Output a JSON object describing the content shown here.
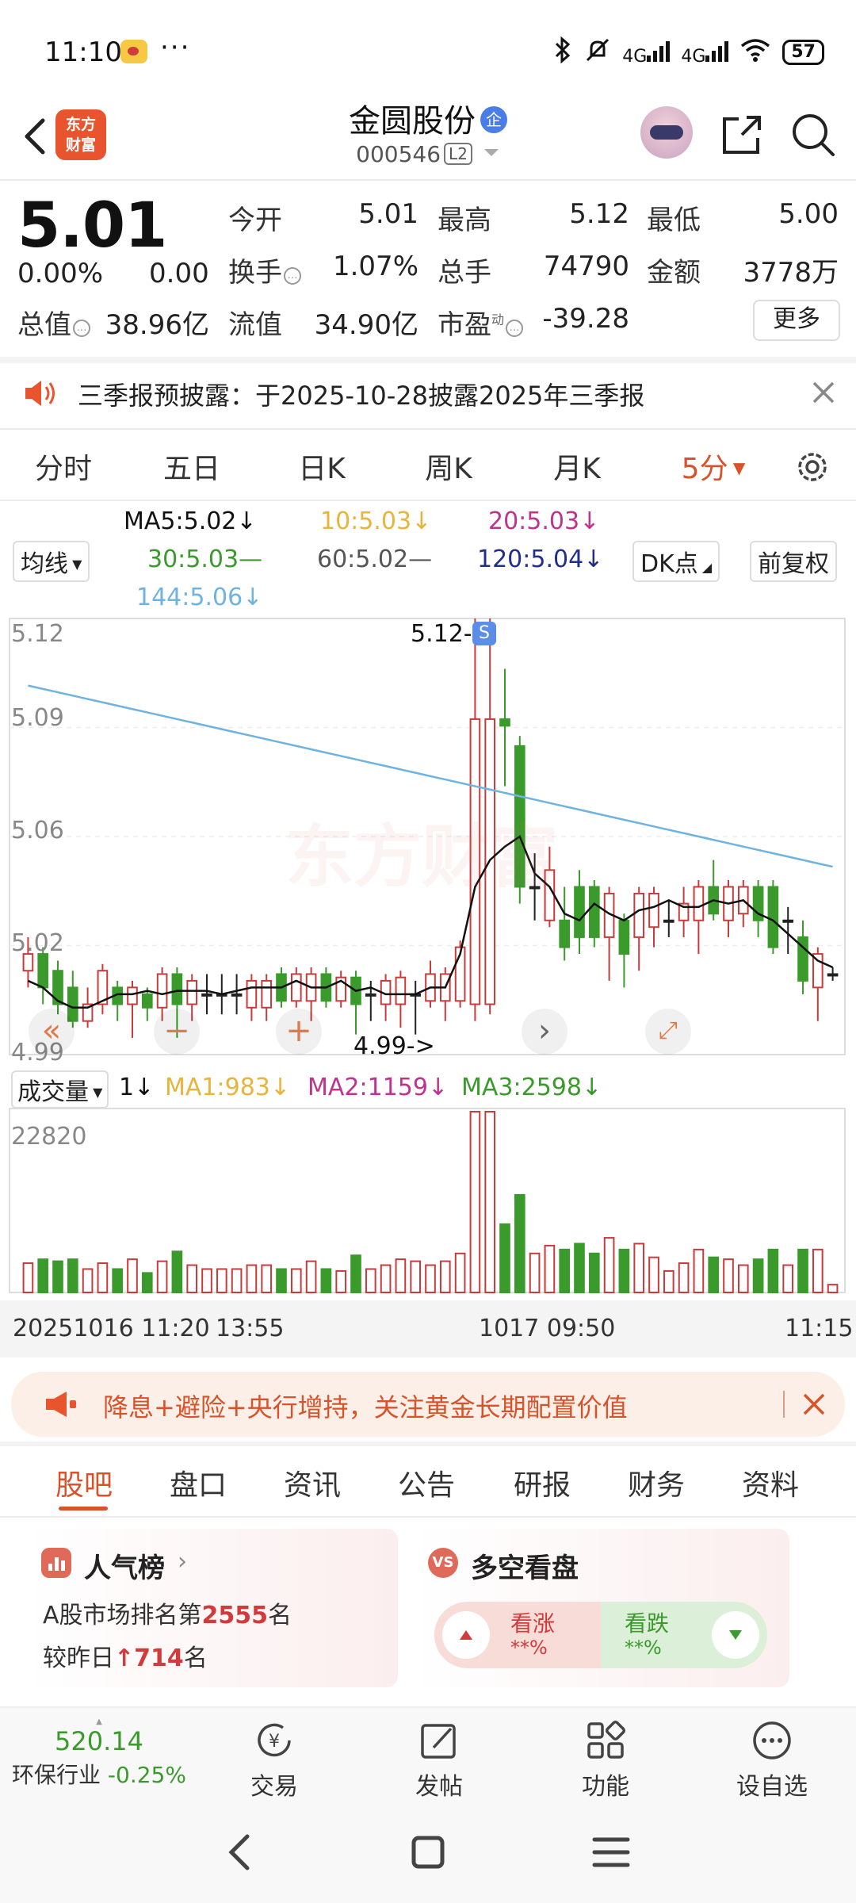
{
  "status_bar": {
    "time": "11:10",
    "dots": "···",
    "net1": "4G",
    "net2": "4G",
    "battery": "57"
  },
  "header": {
    "logo_line1": "东方",
    "logo_line2": "财富",
    "stock_name": "金圆股份",
    "badge": "企",
    "stock_code": "000546",
    "level_badge": "L2"
  },
  "quote": {
    "price": "5.01",
    "change_pct": "0.00%",
    "change_abs": "0.00",
    "open_label": "今开",
    "open": "5.01",
    "high_label": "最高",
    "high": "5.12",
    "low_label": "最低",
    "low": "5.00",
    "turnover_label": "换手",
    "turnover": "1.07%",
    "volume_label": "总手",
    "volume": "74790",
    "amount_label": "金额",
    "amount": "3778万",
    "mktcap_label": "总值",
    "mktcap": "38.96亿",
    "float_label": "流值",
    "float": "34.90亿",
    "pe_label": "市盈",
    "pe_sup": "动",
    "pe": "-39.28",
    "more_label": "更多"
  },
  "notice": {
    "text": "三季报预披露：于2025-10-28披露2025年三季报"
  },
  "period_tabs": [
    "分时",
    "五日",
    "日K",
    "周K",
    "月K",
    "5分"
  ],
  "ma_legend": {
    "selector": "均线",
    "ma5": "MA5:5.02↓",
    "ma10": "10:5.03↓",
    "ma20": "20:5.03↓",
    "ma30": "30:5.03—",
    "ma60": "60:5.02—",
    "ma120": "120:5.04↓",
    "ma144": "144:5.06↓",
    "dk_label": "DK点",
    "adjust_label": "前复权",
    "colors": {
      "ma5": "#111111",
      "ma10": "#e8b43a",
      "ma20": "#c0338c",
      "ma30": "#3a9a2c",
      "ma60": "#555555",
      "ma120": "#1f2f8a",
      "ma144": "#6fb3e0"
    }
  },
  "kline": {
    "y_labels": [
      "5.12",
      "5.09",
      "5.06",
      "5.02",
      "4.99"
    ],
    "high_marker": "5.12->",
    "low_marker": "4.99->",
    "watermark": "东方财富"
  },
  "volume": {
    "selector": "成交量",
    "num": "1↓",
    "ma1": "MA1:983↓",
    "ma2": "MA2:1159↓",
    "ma3": "MA3:2598↓",
    "y_top": "22820",
    "x_labels": [
      "20251016 11:20",
      "13:55",
      "1017 09:50",
      "11:15"
    ]
  },
  "chart_data": {
    "type": "candlestick",
    "ylim": [
      4.99,
      5.12
    ],
    "candles": [
      {
        "o": 5.015,
        "c": 5.02,
        "h": 5.025,
        "l": 5.01
      },
      {
        "o": 5.02,
        "c": 5.01,
        "h": 5.022,
        "l": 5.005
      },
      {
        "o": 5.015,
        "c": 5.005,
        "h": 5.018,
        "l": 5.002
      },
      {
        "o": 5.01,
        "c": 5.0,
        "h": 5.015,
        "l": 4.998
      },
      {
        "o": 5.0,
        "c": 5.005,
        "h": 5.01,
        "l": 4.998
      },
      {
        "o": 5.005,
        "c": 5.015,
        "h": 5.017,
        "l": 5.002
      },
      {
        "o": 5.01,
        "c": 5.005,
        "h": 5.012,
        "l": 5.0
      },
      {
        "o": 5.005,
        "c": 5.01,
        "h": 5.012,
        "l": 4.995
      },
      {
        "o": 5.008,
        "c": 5.004,
        "h": 5.01,
        "l": 5.0
      },
      {
        "o": 5.004,
        "c": 5.014,
        "h": 5.016,
        "l": 5.0
      },
      {
        "o": 5.014,
        "c": 5.005,
        "h": 5.016,
        "l": 4.995
      },
      {
        "o": 5.005,
        "c": 5.012,
        "h": 5.014,
        "l": 5.0
      },
      {
        "o": 5.008,
        "c": 5.008,
        "h": 5.014,
        "l": 5.002
      },
      {
        "o": 5.008,
        "c": 5.008,
        "h": 5.014,
        "l": 5.002
      },
      {
        "o": 5.008,
        "c": 5.008,
        "h": 5.014,
        "l": 5.002
      },
      {
        "o": 5.004,
        "c": 5.012,
        "h": 5.014,
        "l": 5.0
      },
      {
        "o": 5.004,
        "c": 5.012,
        "h": 5.014,
        "l": 5.0
      },
      {
        "o": 5.014,
        "c": 5.006,
        "h": 5.016,
        "l": 5.004
      },
      {
        "o": 5.006,
        "c": 5.014,
        "h": 5.016,
        "l": 5.004
      },
      {
        "o": 5.006,
        "c": 5.014,
        "h": 5.016,
        "l": 5.0
      },
      {
        "o": 5.014,
        "c": 5.006,
        "h": 5.016,
        "l": 5.004
      },
      {
        "o": 5.006,
        "c": 5.013,
        "h": 5.015,
        "l": 5.004
      },
      {
        "o": 5.013,
        "c": 5.005,
        "h": 5.015,
        "l": 4.996
      },
      {
        "o": 5.008,
        "c": 5.008,
        "h": 5.012,
        "l": 5.0
      },
      {
        "o": 5.005,
        "c": 5.012,
        "h": 5.014,
        "l": 5.0
      },
      {
        "o": 5.005,
        "c": 5.013,
        "h": 5.015,
        "l": 4.998
      },
      {
        "o": 5.008,
        "c": 5.008,
        "h": 5.012,
        "l": 4.996
      },
      {
        "o": 5.006,
        "c": 5.014,
        "h": 5.018,
        "l": 5.004
      },
      {
        "o": 5.006,
        "c": 5.014,
        "h": 5.016,
        "l": 5.0
      },
      {
        "o": 5.006,
        "c": 5.022,
        "h": 5.024,
        "l": 5.004
      },
      {
        "o": 5.005,
        "c": 5.09,
        "h": 5.12,
        "l": 5.0
      },
      {
        "o": 5.005,
        "c": 5.09,
        "h": 5.12,
        "l": 5.002
      },
      {
        "o": 5.09,
        "c": 5.088,
        "h": 5.105,
        "l": 5.07
      },
      {
        "o": 5.082,
        "c": 5.04,
        "h": 5.085,
        "l": 5.035
      },
      {
        "o": 5.04,
        "c": 5.04,
        "h": 5.05,
        "l": 5.03
      },
      {
        "o": 5.03,
        "c": 5.045,
        "h": 5.052,
        "l": 5.028
      },
      {
        "o": 5.03,
        "c": 5.022,
        "h": 5.04,
        "l": 5.018
      },
      {
        "o": 5.04,
        "c": 5.025,
        "h": 5.045,
        "l": 5.02
      },
      {
        "o": 5.04,
        "c": 5.025,
        "h": 5.042,
        "l": 5.022
      },
      {
        "o": 5.025,
        "c": 5.038,
        "h": 5.04,
        "l": 5.012
      },
      {
        "o": 5.03,
        "c": 5.02,
        "h": 5.032,
        "l": 5.01
      },
      {
        "o": 5.025,
        "c": 5.038,
        "h": 5.04,
        "l": 5.015
      },
      {
        "o": 5.028,
        "c": 5.038,
        "h": 5.04,
        "l": 5.022
      },
      {
        "o": 5.03,
        "c": 5.03,
        "h": 5.036,
        "l": 5.025
      },
      {
        "o": 5.03,
        "c": 5.035,
        "h": 5.04,
        "l": 5.025
      },
      {
        "o": 5.03,
        "c": 5.04,
        "h": 5.042,
        "l": 5.02
      },
      {
        "o": 5.04,
        "c": 5.032,
        "h": 5.048,
        "l": 5.03
      },
      {
        "o": 5.03,
        "c": 5.04,
        "h": 5.042,
        "l": 5.025
      },
      {
        "o": 5.032,
        "c": 5.04,
        "h": 5.042,
        "l": 5.028
      },
      {
        "o": 5.04,
        "c": 5.03,
        "h": 5.042,
        "l": 5.025
      },
      {
        "o": 5.04,
        "c": 5.022,
        "h": 5.042,
        "l": 5.02
      },
      {
        "o": 5.03,
        "c": 5.03,
        "h": 5.034,
        "l": 5.02
      },
      {
        "o": 5.025,
        "c": 5.012,
        "h": 5.03,
        "l": 5.008
      },
      {
        "o": 5.01,
        "c": 5.02,
        "h": 5.022,
        "l": 5.0
      },
      {
        "o": 5.014,
        "c": 5.014,
        "h": 5.016,
        "l": 5.012
      }
    ],
    "ma5": [
      5.012,
      5.01,
      5.006,
      5.004,
      5.004,
      5.006,
      5.008,
      5.008,
      5.009,
      5.008,
      5.009,
      5.009,
      5.009,
      5.008,
      5.009,
      5.01,
      5.01,
      5.01,
      5.012,
      5.01,
      5.01,
      5.012,
      5.009,
      5.01,
      5.008,
      5.008,
      5.008,
      5.01,
      5.01,
      5.02,
      5.04,
      5.048,
      5.052,
      5.055,
      5.044,
      5.04,
      5.032,
      5.03,
      5.035,
      5.032,
      5.03,
      5.033,
      5.034,
      5.036,
      5.034,
      5.034,
      5.036,
      5.035,
      5.036,
      5.032,
      5.03,
      5.026,
      5.022,
      5.018,
      5.016
    ],
    "ma144": [
      5.1,
      5.099,
      5.098,
      5.097,
      5.096,
      5.095,
      5.094,
      5.093,
      5.092,
      5.091,
      5.09,
      5.089,
      5.088,
      5.087,
      5.086,
      5.085,
      5.084,
      5.083,
      5.082,
      5.081,
      5.08,
      5.079,
      5.078,
      5.077,
      5.076,
      5.075,
      5.074,
      5.073,
      5.072,
      5.071,
      5.07,
      5.069,
      5.068,
      5.067,
      5.066,
      5.065,
      5.064,
      5.063,
      5.062,
      5.061,
      5.06,
      5.059,
      5.058,
      5.057,
      5.056,
      5.055,
      5.054,
      5.053,
      5.052,
      5.051,
      5.05,
      5.049,
      5.048,
      5.047,
      5.046
    ]
  },
  "ad": {
    "text": "降息+避险+央行增持，关注黄金长期配置价值"
  },
  "section_tabs": [
    "股吧",
    "盘口",
    "资讯",
    "公告",
    "研报",
    "财务",
    "资料"
  ],
  "cards": {
    "popular": {
      "title": "人气榜",
      "line1_prefix": "A股市场排名第",
      "rank": "2555",
      "line1_suffix": "名",
      "line2_prefix": "较昨日",
      "delta": "714",
      "line2_suffix": "名"
    },
    "vs": {
      "title": "多空看盘",
      "bull_label": "看涨",
      "bull_val": "**%",
      "bear_label": "看跌",
      "bear_val": "**%"
    }
  },
  "bottom_bar": {
    "index_value": "520.14",
    "index_name": "环保行业",
    "index_change": "-0.25%",
    "items": [
      "交易",
      "发帖",
      "功能",
      "设自选"
    ]
  }
}
